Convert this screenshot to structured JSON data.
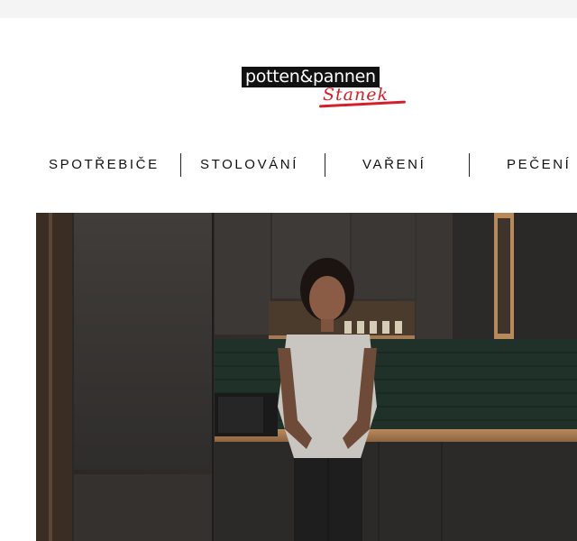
{
  "header": {
    "logo_text": "potten&pannen",
    "logo_script": "Stanek"
  },
  "nav": {
    "items": [
      {
        "label": "SPOTŘEBIČE"
      },
      {
        "label": "STOLOVÁNÍ"
      },
      {
        "label": "VAŘENÍ"
      },
      {
        "label": "PEČENÍ"
      }
    ]
  },
  "colors": {
    "brand_red": "#d4202a",
    "logo_black": "#111111"
  }
}
